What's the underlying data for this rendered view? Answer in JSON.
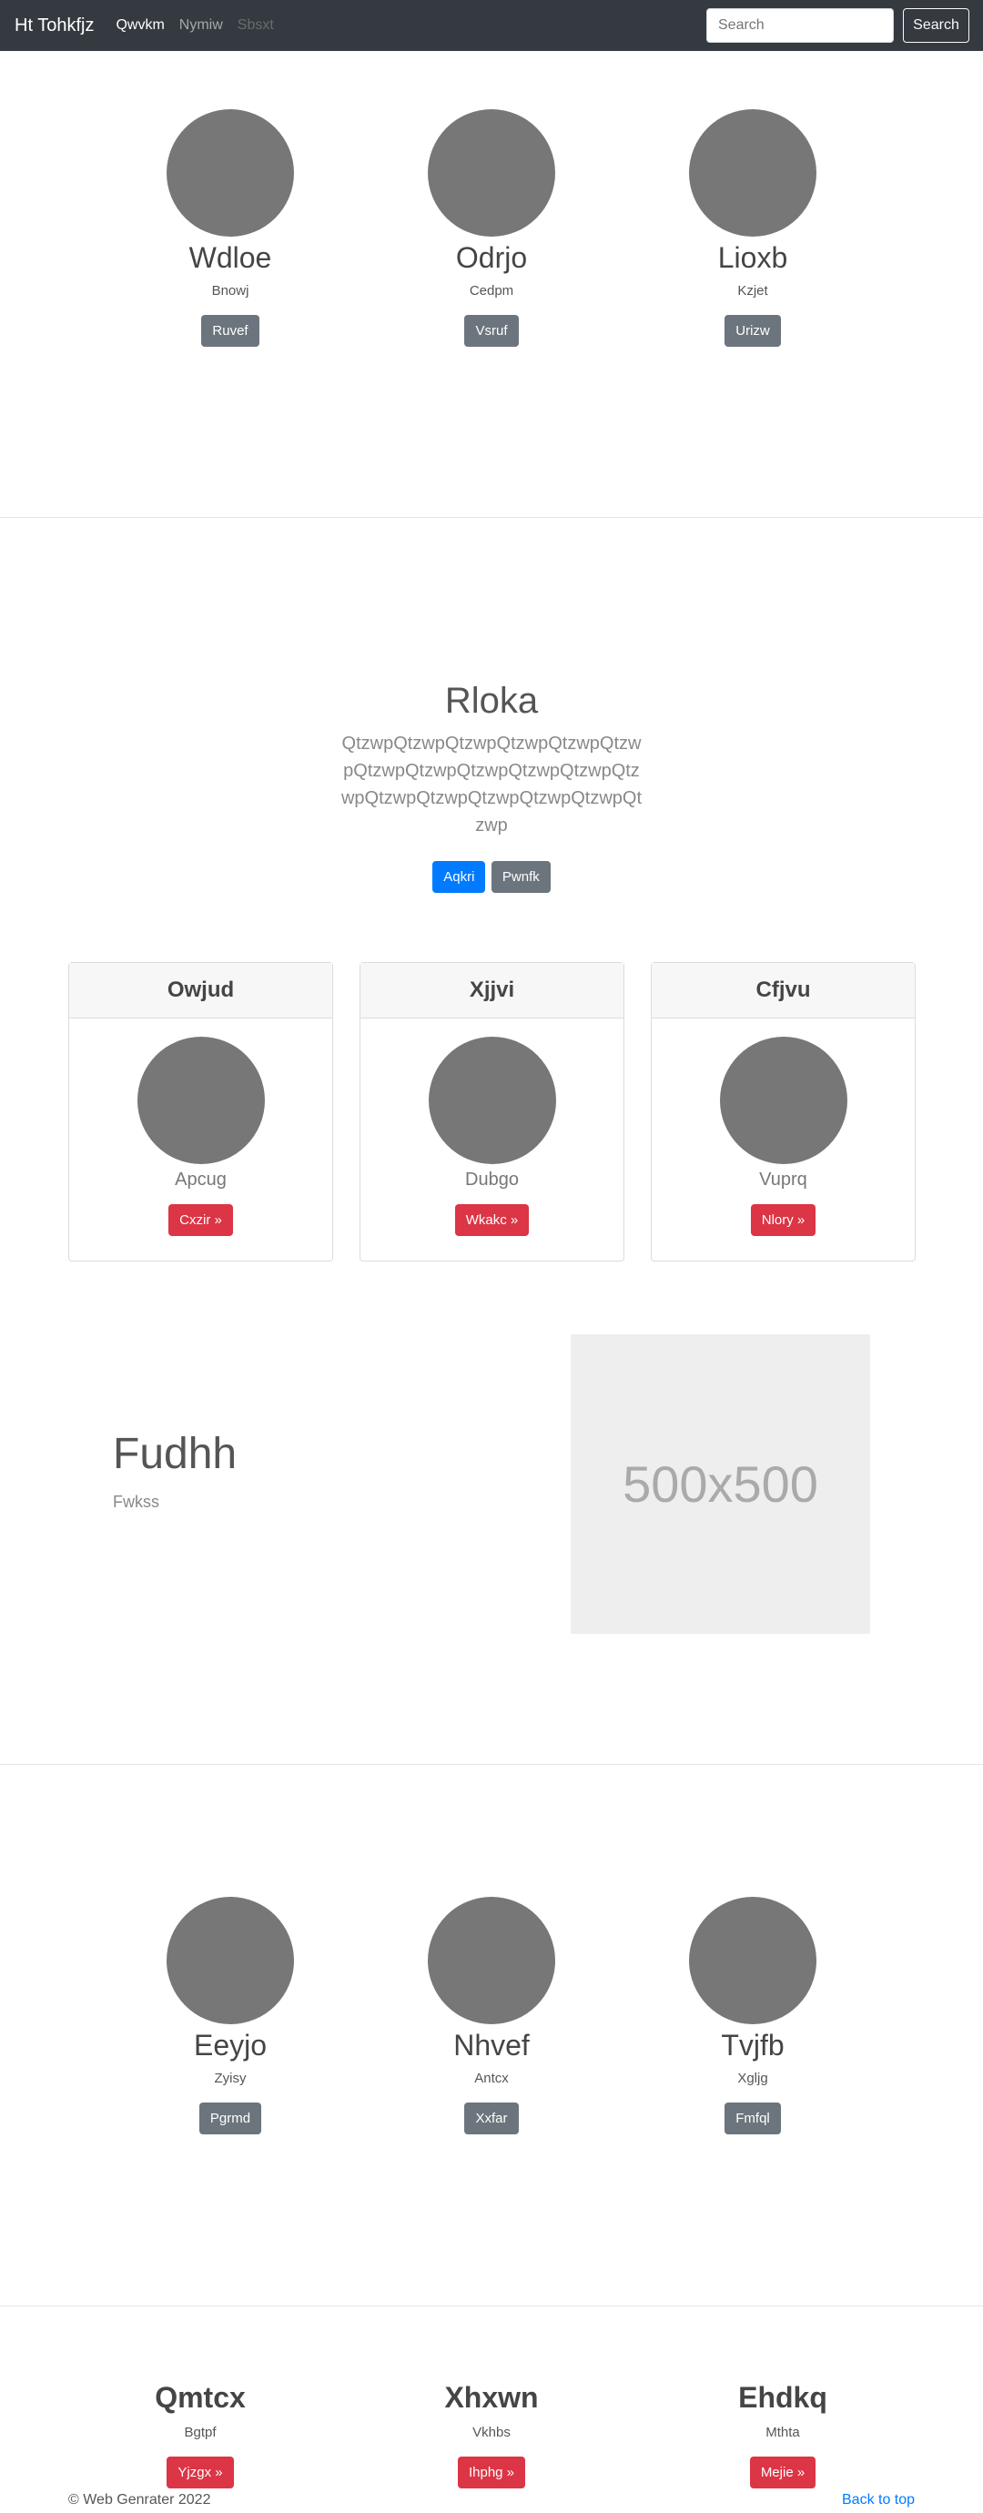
{
  "navbar": {
    "brand": "Ht Tohkfjz",
    "links": [
      {
        "label": "Qwvkm",
        "state": "active"
      },
      {
        "label": "Nymiw",
        "state": "normal"
      },
      {
        "label": "Sbsxt",
        "state": "disabled"
      }
    ],
    "search_placeholder": "Search",
    "search_button": "Search"
  },
  "profiles_top": [
    {
      "name": "Wdloe",
      "subtitle": "Bnowj",
      "button": "Ruvef"
    },
    {
      "name": "Odrjo",
      "subtitle": "Cedpm",
      "button": "Vsruf"
    },
    {
      "name": "Lioxb",
      "subtitle": "Kzjet",
      "button": "Urizw"
    }
  ],
  "hero": {
    "title": "Rloka",
    "text": "QtzwpQtzwpQtzwpQtzwpQtzwpQtzwpQtzwpQtzwpQtzwpQtzwpQtzwpQtzwpQtzwpQtzwpQtzwpQtzwpQtzwpQtzwp",
    "primary_button": "Aqkri",
    "secondary_button": "Pwnfk"
  },
  "cards": [
    {
      "header": "Owjud",
      "name": "Apcug",
      "button": "Cxzir »"
    },
    {
      "header": "Xjjvi",
      "name": "Dubgo",
      "button": "Wkakc »"
    },
    {
      "header": "Cfjvu",
      "name": "Vuprq",
      "button": "Nlory »"
    }
  ],
  "feature": {
    "title": "Fudhh",
    "subtitle": "Fwkss",
    "placeholder_label": "500x500"
  },
  "profiles_bottom": [
    {
      "name": "Eeyjo",
      "subtitle": "Zyisy",
      "button": "Pgrmd"
    },
    {
      "name": "Nhvef",
      "subtitle": "Antcx",
      "button": "Xxfar"
    },
    {
      "name": "Tvjfb",
      "subtitle": "Xgljg",
      "button": "Fmfql"
    }
  ],
  "columns": [
    {
      "title": "Qmtcx",
      "subtitle": "Bgtpf",
      "button": "Yjzgx »"
    },
    {
      "title": "Xhxwn",
      "subtitle": "Vkhbs",
      "button": "Ihphg »"
    },
    {
      "title": "Ehdkq",
      "subtitle": "Mthta",
      "button": "Mejie »"
    }
  ],
  "footer": {
    "copyright": "© Web Genrater 2022",
    "back_to_top": "Back to top"
  },
  "colors": {
    "navbar": "#343a40",
    "primary": "#007bff",
    "secondary": "#6c757d",
    "danger": "#dc3545",
    "avatar": "#777777"
  }
}
